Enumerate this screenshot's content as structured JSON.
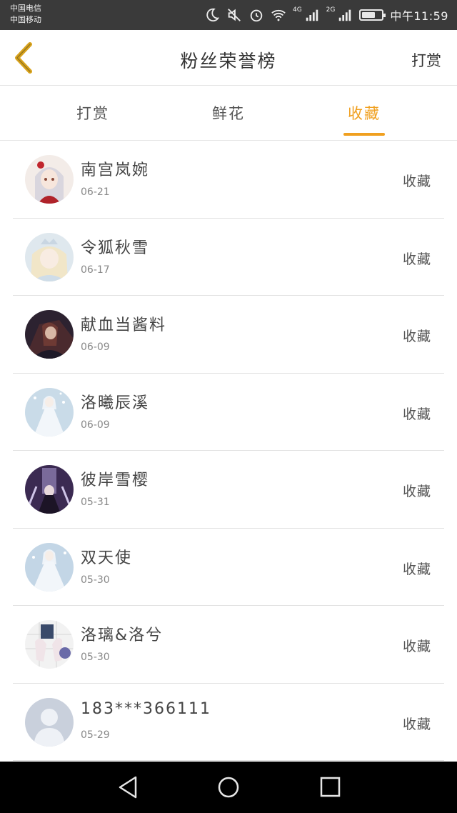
{
  "status_bar": {
    "carrier_1": "中国电信",
    "carrier_2": "中国移动",
    "network_1": "4G",
    "network_2": "2G",
    "time": "中午11:59",
    "icons": [
      "moon-icon",
      "mute-icon",
      "alarm-icon",
      "wifi-icon",
      "signal-icon",
      "signal-icon",
      "battery-icon"
    ]
  },
  "header": {
    "title": "粉丝荣誉榜",
    "action_label": "打赏",
    "back_icon": "chevron-left-icon",
    "back_color": "#d8a21c"
  },
  "tabs": [
    {
      "label": "打赏",
      "active": false
    },
    {
      "label": "鲜花",
      "active": false
    },
    {
      "label": "收藏",
      "active": true
    }
  ],
  "accent_color": "#f0a020",
  "fans": [
    {
      "name": "南宫岚婉",
      "date": "06-21",
      "type": "收藏",
      "avatar": "anime-girl-red-avatar"
    },
    {
      "name": "令狐秋雪",
      "date": "06-17",
      "type": "收藏",
      "avatar": "anime-girl-crown-avatar"
    },
    {
      "name": "献血当酱料",
      "date": "06-09",
      "type": "收藏",
      "avatar": "dark-anime-avatar"
    },
    {
      "name": "洛曦辰溪",
      "date": "06-09",
      "type": "收藏",
      "avatar": "white-dress-avatar"
    },
    {
      "name": "彼岸雪樱",
      "date": "05-31",
      "type": "收藏",
      "avatar": "purple-gothic-avatar"
    },
    {
      "name": "双天使",
      "date": "05-30",
      "type": "收藏",
      "avatar": "white-dress-avatar"
    },
    {
      "name": "洛璃&洛兮",
      "date": "05-30",
      "type": "收藏",
      "avatar": "hands-avatar"
    },
    {
      "name": "183***366111",
      "date": "05-29",
      "type": "收藏",
      "avatar": "default-user-avatar"
    }
  ],
  "nav_bar": {
    "icons": [
      "back-triangle-icon",
      "home-circle-icon",
      "recents-square-icon"
    ]
  }
}
